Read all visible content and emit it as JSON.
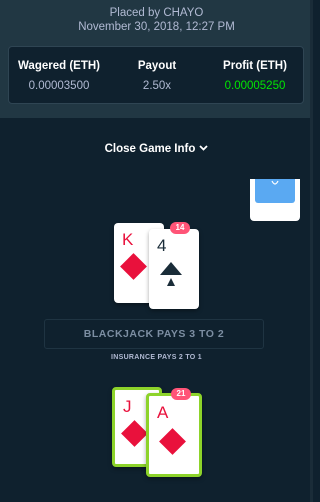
{
  "header": {
    "placed_by": "Placed by CHAYO",
    "date": "November 30, 2018, 12:27 PM"
  },
  "stats": {
    "wagered_label": "Wagered (ETH)",
    "wagered_value": "0.00003500",
    "payout_label": "Payout",
    "payout_value": "2.50x",
    "profit_label": "Profit (ETH)",
    "profit_value": "0.00005250"
  },
  "close_info": {
    "label": "Close Game Info",
    "icon": "chevron-down-icon"
  },
  "dealer": {
    "total": "14",
    "cards": [
      {
        "rank": "K",
        "suit": "diamonds"
      },
      {
        "rank": "4",
        "suit": "spades"
      }
    ]
  },
  "table": {
    "pays_text": "BLACKJACK PAYS 3 TO 2",
    "insurance_text": "INSURANCE PAYS 2 TO 1"
  },
  "player": {
    "total": "21",
    "cards": [
      {
        "rank": "J",
        "suit": "diamonds"
      },
      {
        "rank": "A",
        "suit": "diamonds"
      }
    ]
  },
  "colors": {
    "background": "#0f212e",
    "panel": "#213743",
    "profit": "#00e701",
    "win_border": "#8dd32a",
    "badge": "#ff5477",
    "red_suit": "#e9113c",
    "deck_blue": "#5aa9f2"
  }
}
